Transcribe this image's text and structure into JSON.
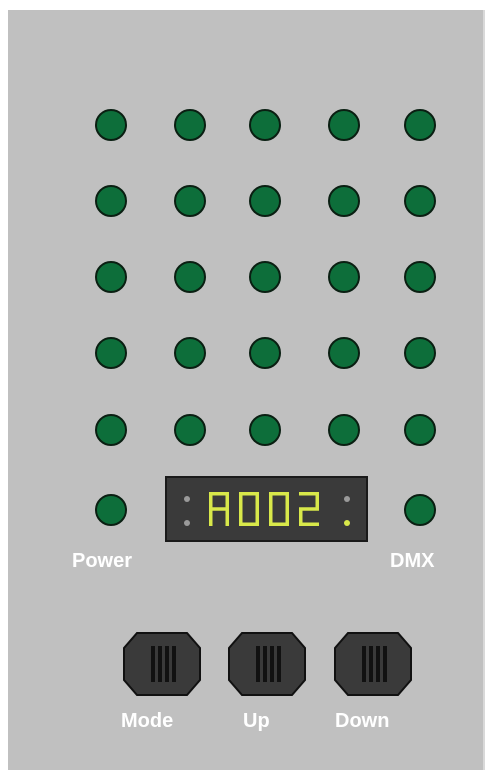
{
  "device": {
    "display_text": "A002",
    "power_label": "Power",
    "dmx_label": "DMX"
  },
  "buttons": [
    {
      "label": "Mode"
    },
    {
      "label": "Up"
    },
    {
      "label": "Down"
    }
  ],
  "colors": {
    "panel": "#c0c0c0",
    "led_on": "#0d6e3a",
    "display_bg": "#3a3a3a",
    "segment": "#d8e84a",
    "button_body": "#3a3a3a"
  }
}
